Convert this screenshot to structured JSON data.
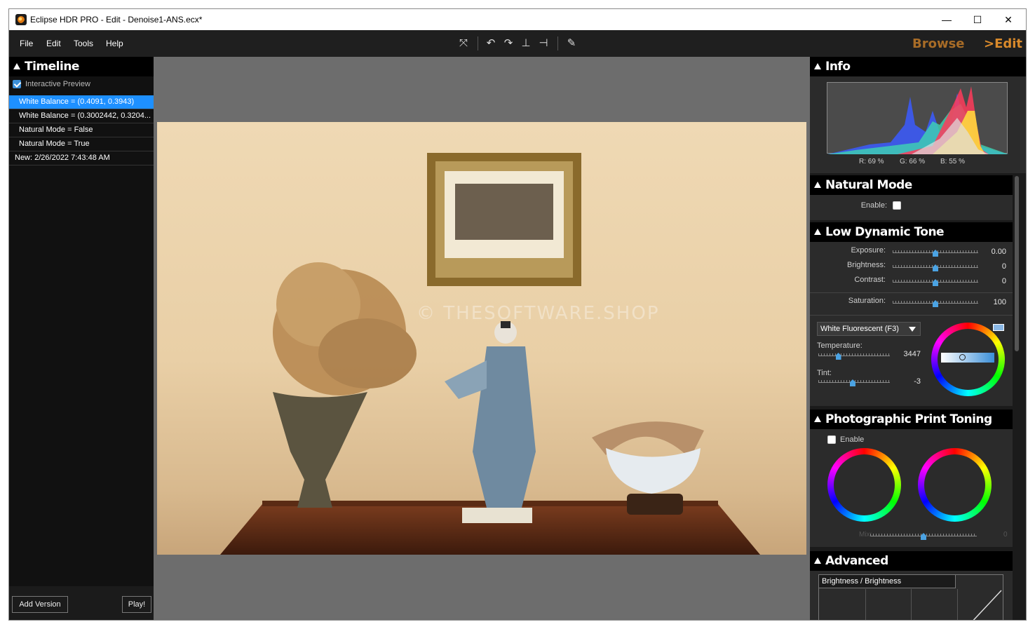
{
  "window": {
    "title": "Eclipse HDR PRO - Edit - Denoise1-ANS.ecx*",
    "minimize": "—",
    "maximize": "☐",
    "close": "✕"
  },
  "menu": {
    "file": "File",
    "edit": "Edit",
    "tools": "Tools",
    "help": "Help"
  },
  "toolbar": {
    "icons": [
      "fit-screen-icon",
      "rotate-left-icon",
      "rotate-right-icon",
      "flip-vertical-icon",
      "flip-horizontal-icon",
      "brush-icon"
    ]
  },
  "modes": {
    "browse": "Browse",
    "edit": ">Edit"
  },
  "timeline": {
    "title": "Timeline",
    "interactive_preview": "Interactive Preview",
    "interactive_preview_checked": true,
    "items": [
      "White Balance = (0.4091, 0.3943)",
      "White Balance  = (0.3002442, 0.3204...",
      "Natural Mode = False",
      "Natural Mode = True",
      "New: 2/26/2022 7:43:48 AM"
    ],
    "selected_index": 0,
    "add_version": "Add Version",
    "play": "Play!"
  },
  "preview": {
    "watermark": "© THESOFTWARE.SHOP"
  },
  "info": {
    "title": "Info",
    "r": "R: 69 %",
    "g": "G: 66 %",
    "b": "B: 55 %"
  },
  "natural_mode": {
    "title": "Natural Mode",
    "enable_label": "Enable:",
    "enabled": false
  },
  "low_dynamic_tone": {
    "title": "Low Dynamic Tone",
    "sliders": [
      {
        "label": "Exposure:",
        "value": "0.00",
        "level": 0.5
      },
      {
        "label": "Brightness:",
        "value": "0",
        "level": 0.5
      },
      {
        "label": "Contrast:",
        "value": "0",
        "level": 0.5
      },
      {
        "label": "Saturation:",
        "value": "100",
        "level": 0.5
      }
    ],
    "white_balance_preset": "White Fluorescent (F3)",
    "temperature_label": "Temperature:",
    "temperature_value": "3447",
    "temperature_level": 0.28,
    "tint_label": "Tint:",
    "tint_value": "-3",
    "tint_level": 0.48
  },
  "print_toning": {
    "title": "Photographic Print Toning",
    "enable_label": "Enable",
    "enabled": false,
    "mix_label": "Mix:",
    "mix_value": "0"
  },
  "advanced": {
    "title": "Advanced",
    "curve_selector": "Brightness / Brightness"
  },
  "colors": {
    "accent": "#1e90ff",
    "mode_orange": "#d98a2b",
    "panel_bg": "#2b2b2b",
    "slider_thumb": "#4ba3e3"
  }
}
